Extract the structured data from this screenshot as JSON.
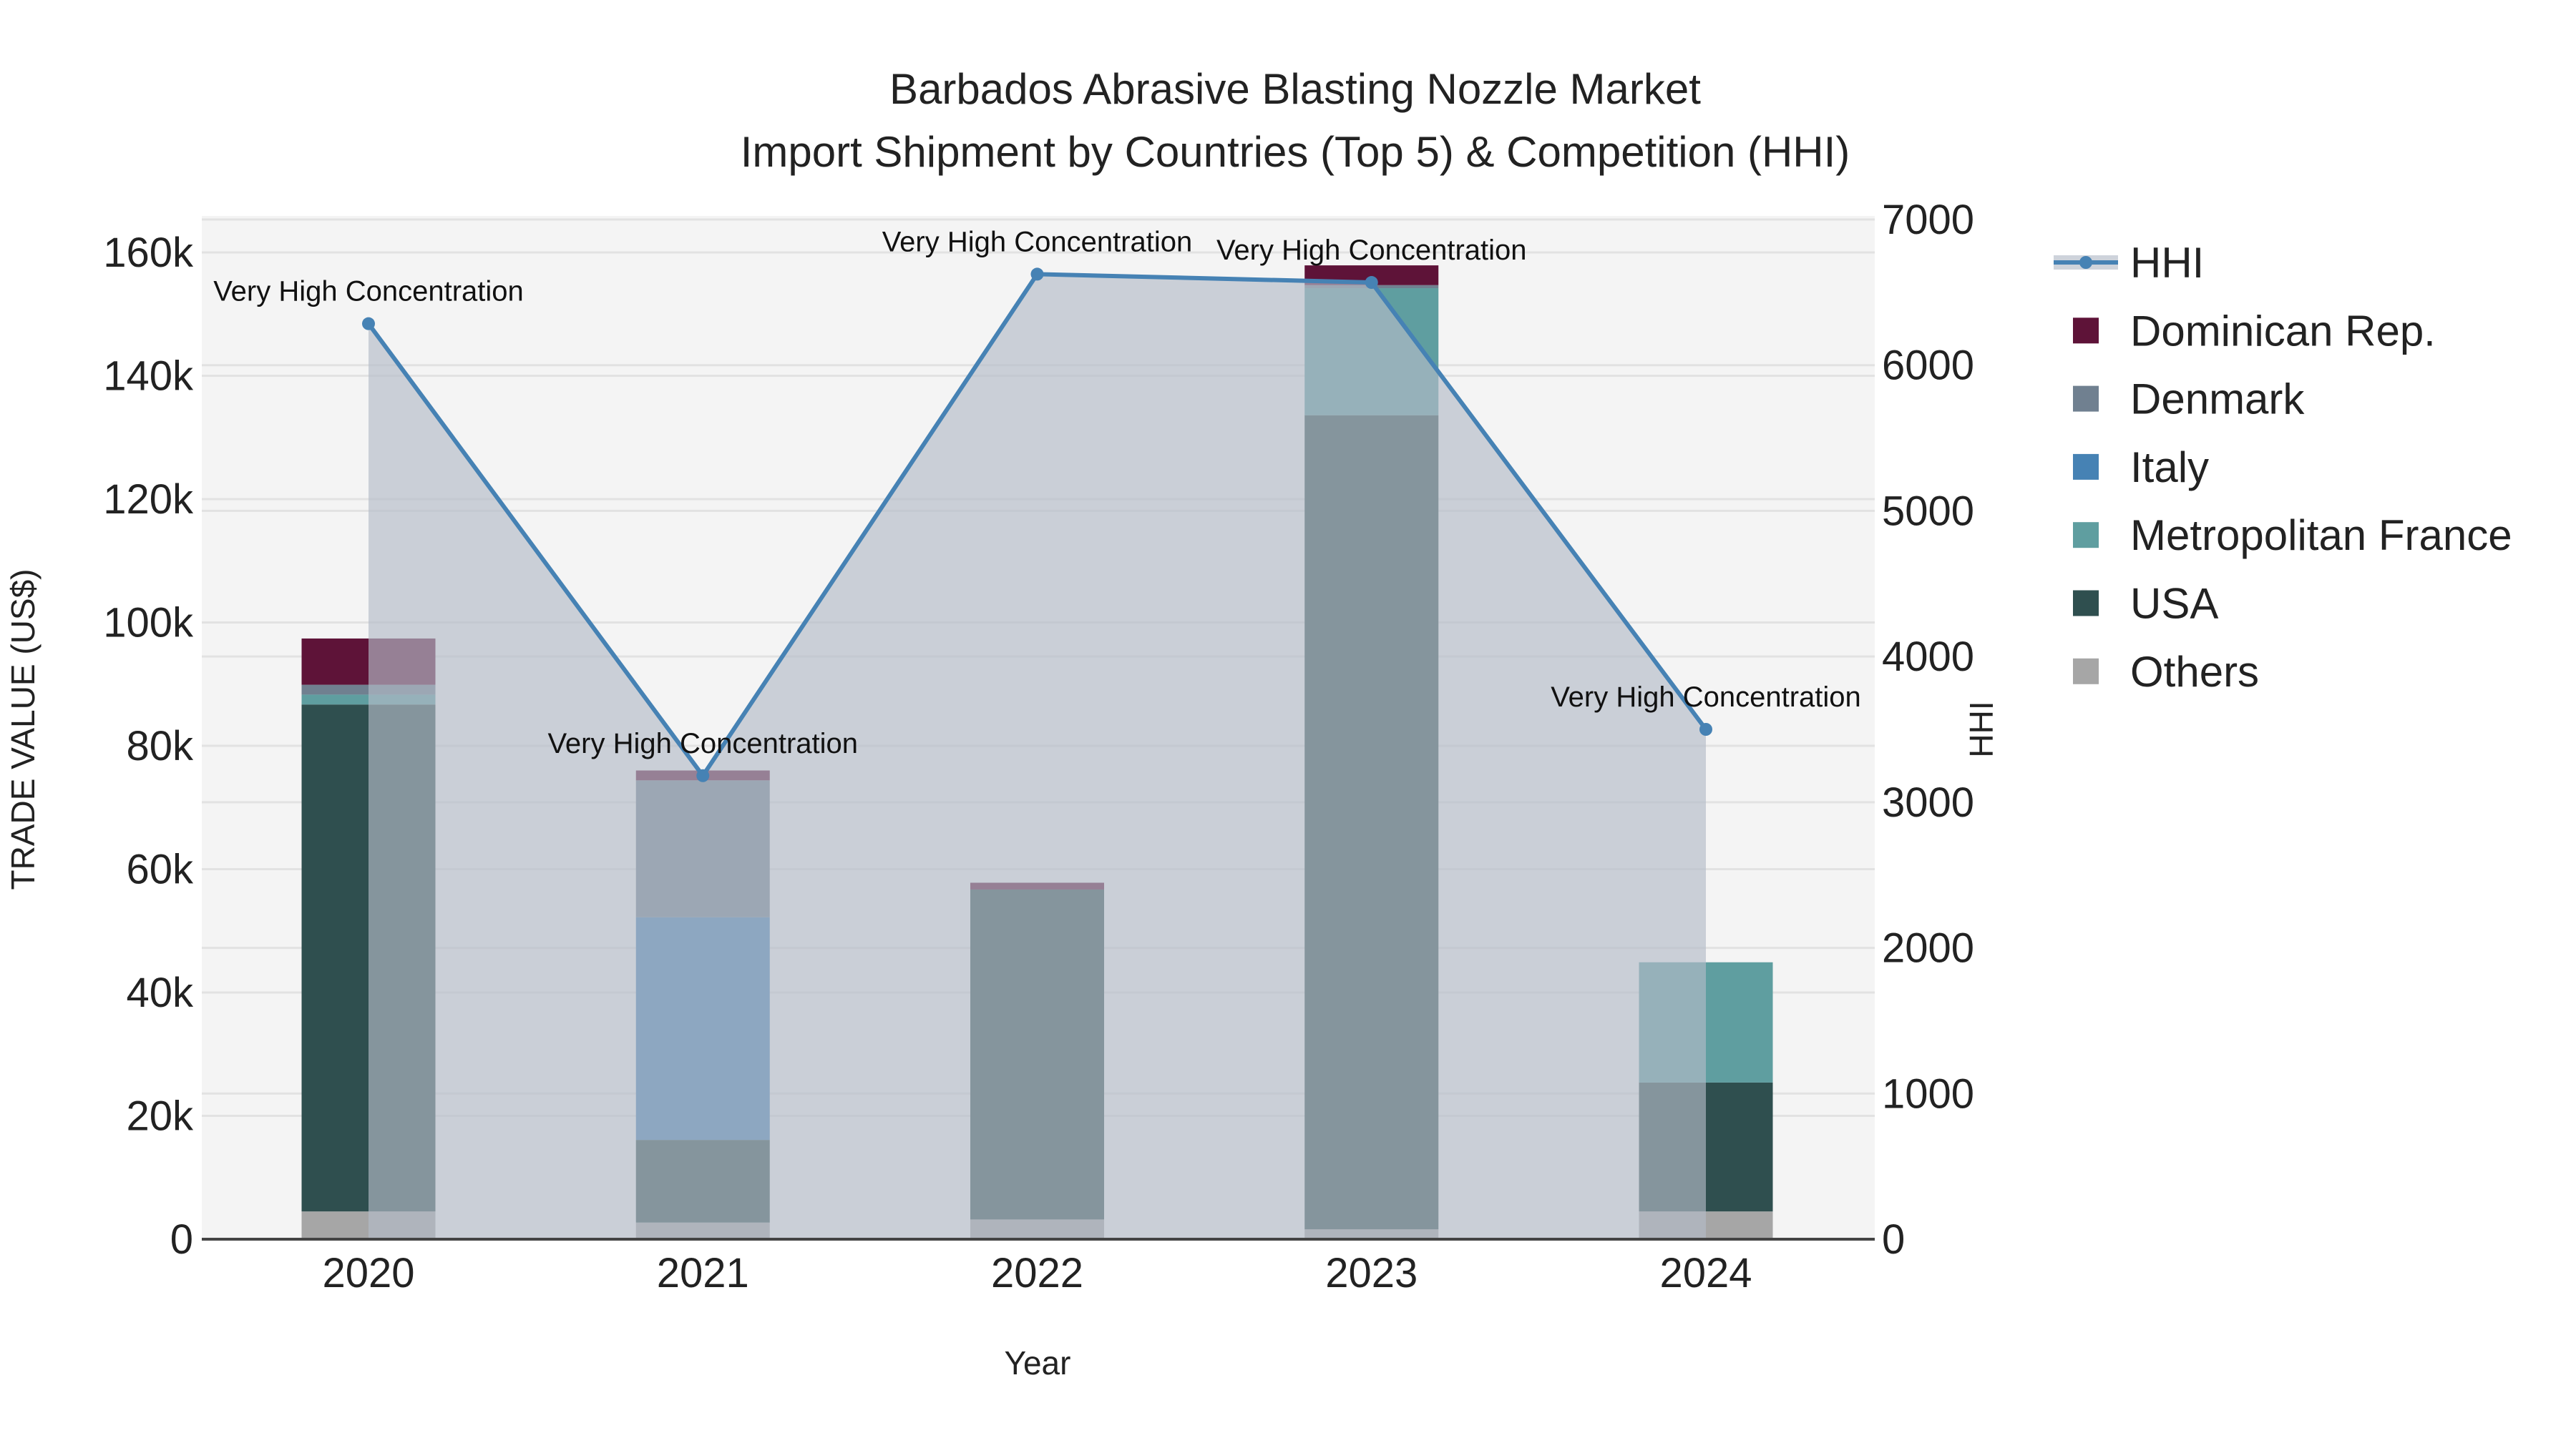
{
  "chart_data": {
    "type": "bar",
    "title": "Barbados Abrasive Blasting Nozzle Market",
    "subtitle": "Import Shipment by Countries (Top 5) & Competition (HHI)",
    "xlabel": "Year",
    "ylabel": "TRADE VALUE (US$)",
    "y2label": "HHI",
    "categories": [
      "2020",
      "2021",
      "2022",
      "2023",
      "2024"
    ],
    "ylim": [
      0,
      165000
    ],
    "y2lim": [
      0,
      7000
    ],
    "yticks": [
      0,
      20000,
      40000,
      60000,
      80000,
      100000,
      120000,
      140000,
      160000
    ],
    "ytick_labels": [
      "0",
      "20k",
      "40k",
      "60k",
      "80k",
      "100k",
      "120k",
      "140k",
      "160k"
    ],
    "y2ticks": [
      0,
      1000,
      2000,
      3000,
      4000,
      5000,
      6000,
      7000
    ],
    "y2tick_labels": [
      "0",
      "1000",
      "2000",
      "3000",
      "4000",
      "5000",
      "6000",
      "7000"
    ],
    "stacked": true,
    "series": [
      {
        "name": "Others",
        "color": "#a6a6a6",
        "values": [
          4500,
          2700,
          3200,
          1600,
          4500
        ]
      },
      {
        "name": "USA",
        "color": "#2f4f4f",
        "values": [
          82200,
          13400,
          53500,
          132000,
          20900
        ]
      },
      {
        "name": "Metropolitan France",
        "color": "#5f9ea0",
        "values": [
          1600,
          0,
          0,
          20600,
          19500
        ]
      },
      {
        "name": "Italy",
        "color": "#4682b4",
        "values": [
          0,
          36100,
          0,
          0,
          0
        ]
      },
      {
        "name": "Denmark",
        "color": "#708090",
        "values": [
          1600,
          22200,
          0,
          500,
          0
        ]
      },
      {
        "name": "Dominican Rep.",
        "color": "#5e1338",
        "values": [
          7500,
          1600,
          1100,
          3200,
          0
        ]
      }
    ],
    "hhi": {
      "name": "HHI",
      "color": "#4682b4",
      "values": [
        6285,
        3182,
        6625,
        6568,
        3500
      ],
      "annotations": [
        "Very High Concentration",
        "Very High Concentration",
        "Very High Concentration",
        "Very High Concentration",
        "Very High Concentration"
      ]
    },
    "legend_order": [
      "HHI",
      "Dominican Rep.",
      "Denmark",
      "Italy",
      "Metropolitan France",
      "USA",
      "Others"
    ],
    "legend_position": "right",
    "grid": true
  }
}
